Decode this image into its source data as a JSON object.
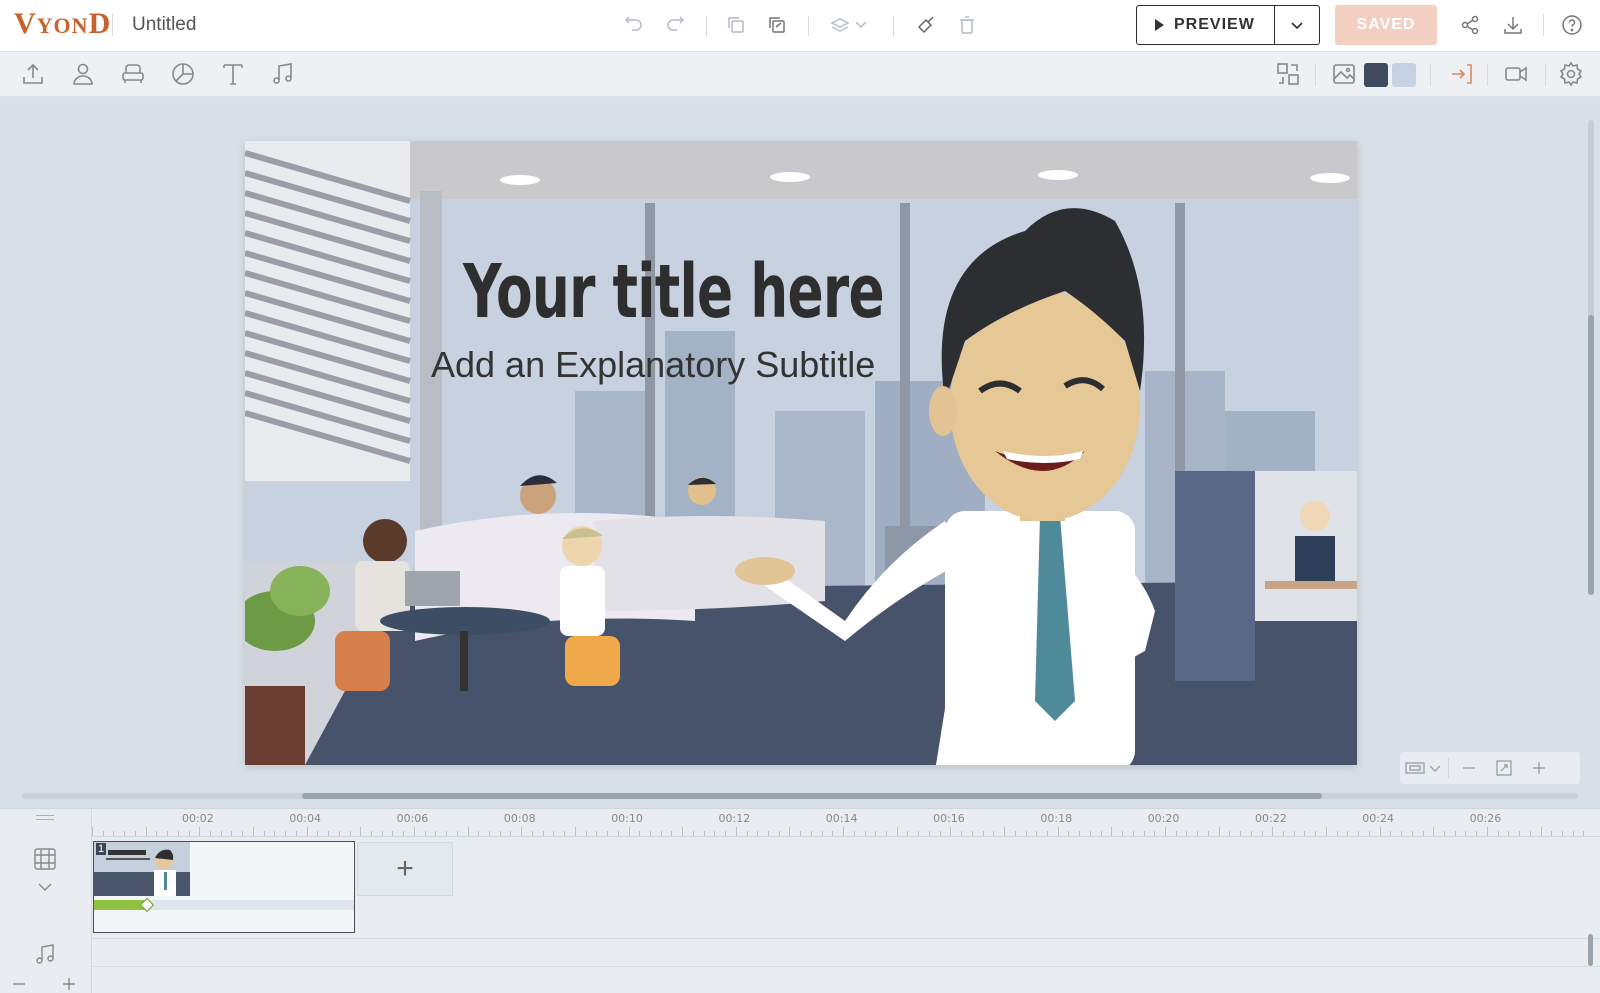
{
  "app": {
    "logo": "VYOND",
    "title": "Untitled"
  },
  "header": {
    "preview_label": "PREVIEW",
    "saved_label": "SAVED"
  },
  "scene": {
    "title": "Your title here",
    "subtitle": "Add an Explanatory Subtitle"
  },
  "timeline": {
    "ticks": [
      "00:02",
      "00:04",
      "00:06",
      "00:08",
      "00:10",
      "00:12",
      "00:14",
      "00:16",
      "00:18",
      "00:20",
      "00:22",
      "00:24",
      "00:26"
    ],
    "scene_number": "1",
    "add_label": "+"
  },
  "colors": {
    "brand": "#c9622b",
    "saved": "#f2cfc0",
    "swatch_dark": "#3e4a5e",
    "swatch_light": "#c6d2e2",
    "progress": "#8fc241"
  },
  "icons": {
    "toolbar": [
      "undo-icon",
      "redo-icon",
      "copy-icon",
      "paste-icon",
      "layers-icon",
      "brush-icon",
      "trash-icon"
    ],
    "right": [
      "share-icon",
      "download-icon",
      "help-icon"
    ],
    "assets": [
      "upload-icon",
      "character-icon",
      "prop-icon",
      "chart-icon",
      "text-icon",
      "music-icon"
    ],
    "scene_tools": [
      "swap-icon",
      "image-icon",
      "enter-icon",
      "camera-icon",
      "settings-icon"
    ]
  }
}
